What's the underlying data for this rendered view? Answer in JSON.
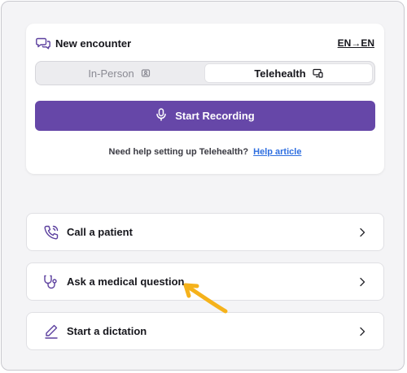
{
  "encounter": {
    "title": "New encounter",
    "language_toggle": "EN→EN",
    "mode_tabs": [
      {
        "label": "In-Person",
        "icon": "person-badge-icon",
        "selected": false
      },
      {
        "label": "Telehealth",
        "icon": "video-screen-icon",
        "selected": true
      }
    ],
    "record_button": "Start Recording",
    "help_text": "Need help setting up Telehealth?",
    "help_link": "Help article"
  },
  "actions": [
    {
      "label": "Call a patient",
      "icon": "phone-icon"
    },
    {
      "label": "Ask a medical question",
      "icon": "stethoscope-icon"
    },
    {
      "label": "Start a dictation",
      "icon": "pen-icon"
    }
  ],
  "colors": {
    "accent": "#6647a8",
    "link": "#2f6fe0",
    "annotation_arrow": "#f5b21b",
    "background": "#f4f4f6"
  }
}
